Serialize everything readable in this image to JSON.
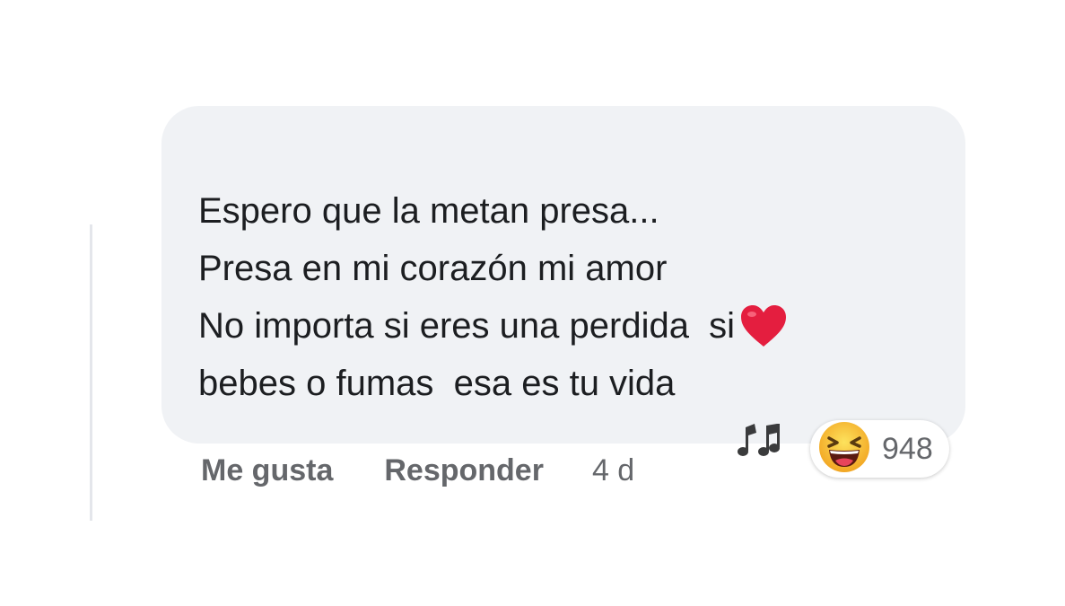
{
  "comment": {
    "lines": [
      "Espero que la metan presa...",
      "Presa en mi corazón mi amor",
      "No importa si eres una perdida  si",
      "bebes o fumas  esa es tu vida"
    ],
    "inline_icons": [
      "heart-emoji",
      "musical-notes-emoji"
    ]
  },
  "reactions": {
    "icon": "laughing-emoji",
    "count": "948"
  },
  "actions": {
    "like_label": "Me gusta",
    "reply_label": "Responder",
    "timestamp": "4 d"
  },
  "colors": {
    "bubble_bg": "#f0f2f5",
    "text": "#1c1e21",
    "secondary_text": "#65676b",
    "heart": "#e41e3f",
    "emoji_yellow": "#f7c137"
  }
}
